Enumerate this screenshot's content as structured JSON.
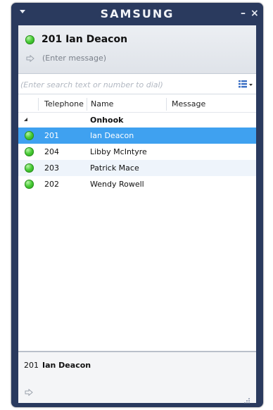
{
  "window": {
    "brand": "SAMSUNG",
    "minimize_glyph": "–",
    "close_glyph": "×"
  },
  "header": {
    "status_icon": "status-green-icon",
    "title": "201 Ian Deacon",
    "message_placeholder": "(Enter message)"
  },
  "search": {
    "placeholder": "(Enter search text or number to dial)"
  },
  "columns": {
    "telephone": "Telephone",
    "name": "Name",
    "message": "Message"
  },
  "group": {
    "label": "Onhook"
  },
  "contacts": [
    {
      "telephone": "201",
      "name": "Ian Deacon",
      "selected": true
    },
    {
      "telephone": "204",
      "name": "Libby McIntyre",
      "selected": false
    },
    {
      "telephone": "203",
      "name": "Patrick Mace",
      "selected": false
    },
    {
      "telephone": "202",
      "name": "Wendy Rowell",
      "selected": false
    }
  ],
  "footer": {
    "telephone": "201",
    "name": "Ian Deacon"
  },
  "colors": {
    "frame": "#2a3a5e",
    "selection": "#3fa1f0",
    "status_green": "#49cc36"
  }
}
